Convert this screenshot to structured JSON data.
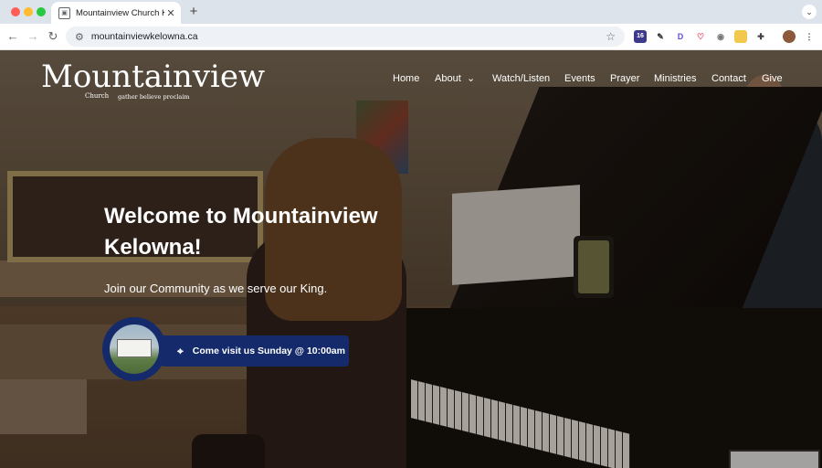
{
  "browser": {
    "tab_title": "Mountainview Church Kelown",
    "tab_close": "✕",
    "new_tab": "+",
    "url": "mountainviewkelowna.ca",
    "traffic_colors": [
      "#ff5f57",
      "#febc2e",
      "#28c840"
    ],
    "extension_badge": "16",
    "extensions": [
      "extension-badge-icon",
      "pen-icon",
      "d-icon",
      "pocket-icon",
      "camera-icon",
      "tag-icon",
      "puzzle-icon",
      "avatar"
    ]
  },
  "site": {
    "logo": {
      "wordmark": "Mountainview",
      "church": "Church",
      "tagline": "gather believe proclaim"
    },
    "nav": [
      {
        "label": "Home"
      },
      {
        "label": "About",
        "dropdown": true
      },
      {
        "label": "Watch/Listen"
      },
      {
        "label": "Events"
      },
      {
        "label": "Prayer"
      },
      {
        "label": "Ministries"
      },
      {
        "label": "Contact"
      },
      {
        "label": "Give"
      }
    ],
    "hero": {
      "headline": "Welcome to Mountainview Kelowna!",
      "subline": "Join our Community as we serve our King.",
      "cta_label": "Come visit us Sunday @ 10:00am"
    },
    "colors": {
      "cta_bg": "#142a6a",
      "nav_text": "#ffffff"
    }
  }
}
